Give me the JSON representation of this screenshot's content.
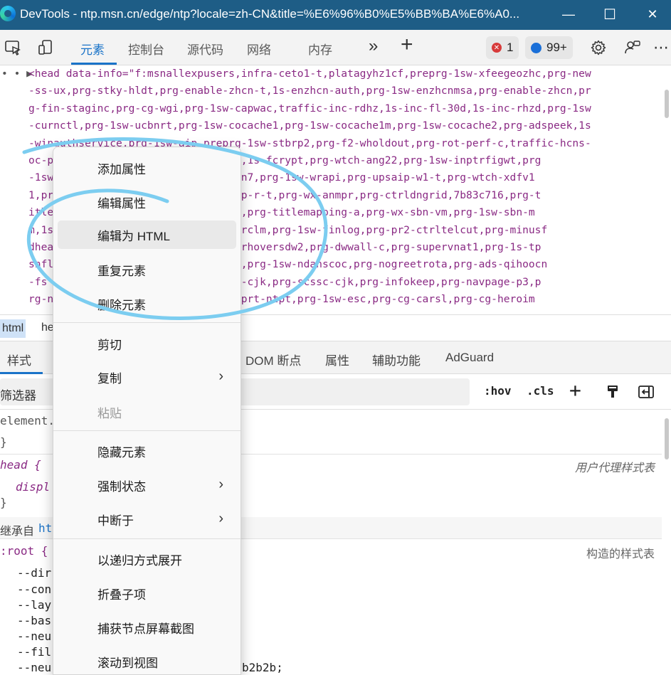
{
  "window": {
    "title": "DevTools - ntp.msn.cn/edge/ntp?locale=zh-CN&title=%E6%96%B0%E5%BB%BA%E6%A0...",
    "minimize": "—",
    "maximize": "☐",
    "close": "✕"
  },
  "toolbar": {
    "tabs": [
      "元素",
      "控制台",
      "源代码",
      "网络",
      "内存"
    ],
    "more": "»",
    "add": "+",
    "errors_count": "1",
    "messages_count": "99+"
  },
  "elements": {
    "prefix": "• • ▶",
    "lines": [
      "<head data-info=\"f:msnallexpusers,infra-ceto1-t,platagyhz1cf,preprg-1sw-xfeegeozhc,prg-new",
      "-ss-ux,prg-stky-hldt,prg-enable-zhcn-t,1s-enzhcn-auth,prg-1sw-enzhcnmsa,prg-enable-zhcn,pr",
      "g-fin-staginc,prg-cg-wgi,prg-1sw-capwac,traffic-inc-rdhz,1s-inc-fl-30d,1s-inc-rhzd,prg-1sw",
      "-curnctl,prg-1sw-ucbnrt,prg-1sw-cocache1,prg-1sw-cocache1m,prg-1sw-cocache2,prg-adspeek,1s",
      "-winauthservice,prg-1sw-aip,preprg-1sw-stbrp2,prg-f2-wholdout,prg-rot-perf-c,traffic-hcns-",
      "oc-p                  leed,prg-ias,1s-fcrypt,prg-wtch-ang22,prg-1sw-inptrfigwt,prg",
      "-1sw                  ,prg-1sw-c2bn7,prg-1sw-wrapi,prg-upsaip-w1-t,prg-wtch-xdfv1",
      "1,pr                  cc,prg-upsaip-r-t,prg-wx-anmpr,prg-ctrldngrid,7b83c716,prg-t",
      "itle                  g-edg-tmtrig,prg-titlemapping-a,prg-wx-sbn-vm,prg-1sw-sbn-m",
      "m,1s                  prg-1sw-p1wtrclm,prg-1sw-finlog,prg-pr2-ctrltelcut,prg-minusf",
      "dhea                  test-3,prg-srhoversdw2,prg-dwwall-c,prg-supervnat1,prg-1s-tp",
      "snfl                  prg-ip-r-ctl,prg-1sw-ndanscoc,prg-nogreetrota,prg-ads-qihoocn",
      "-fs                   n,prg-scards-cjk,prg-scssc-cjk,prg-infokeep,prg-navpage-p3,p",
      "rg-n                  t,prg-1sp-esprt-ntpt,prg-1sw-esc,prg-cg-carsl,prg-cg-heroim"
    ]
  },
  "breadcrumb": [
    "html",
    "he"
  ],
  "lower_tabs": [
    "样式",
    "DOM 断点",
    "属性",
    "辅助功能",
    "AdGuard"
  ],
  "filter": {
    "placeholder": "筛选器",
    "hov": ":hov",
    "cls": ".cls",
    "add": "+"
  },
  "styles": {
    "element_selector": "element.",
    "close_brace_1": "}",
    "head_selector": "head {",
    "head_prop": "displ",
    "close_brace_2": "}",
    "user_agent_label": "用户代理样式表",
    "inherited_prefix": "继承自 ",
    "inherited_from": "ht",
    "root_selector": ":root {",
    "constructed_label": "构造的样式表",
    "root_props": [
      "--dir",
      "--con",
      "--lay",
      "--bas",
      "--neu",
      "--fil",
      "--neu"
    ],
    "tail_value": "b2b2b;"
  },
  "context_menu": {
    "items": [
      {
        "label": "添加属性"
      },
      {
        "label": "编辑属性"
      },
      {
        "label": "编辑为 HTML"
      },
      {
        "label": "重复元素"
      },
      {
        "label": "删除元素"
      },
      {
        "label": "剪切"
      },
      {
        "label": "复制",
        "submenu": "›"
      },
      {
        "label": "粘贴"
      },
      {
        "label": "隐藏元素"
      },
      {
        "label": "强制状态",
        "submenu": "›"
      },
      {
        "label": "中断于",
        "submenu": "›"
      },
      {
        "label": "以递归方式展开"
      },
      {
        "label": "折叠子项"
      },
      {
        "label": "捕获节点屏幕截图"
      },
      {
        "label": "滚动到视图"
      }
    ],
    "highlighted_index": 2,
    "disabled_index": 7
  },
  "colors": {
    "titlebar": "#1e5d86",
    "accent": "#1a73c8",
    "annotation_stroke": "#7ccdf0"
  }
}
